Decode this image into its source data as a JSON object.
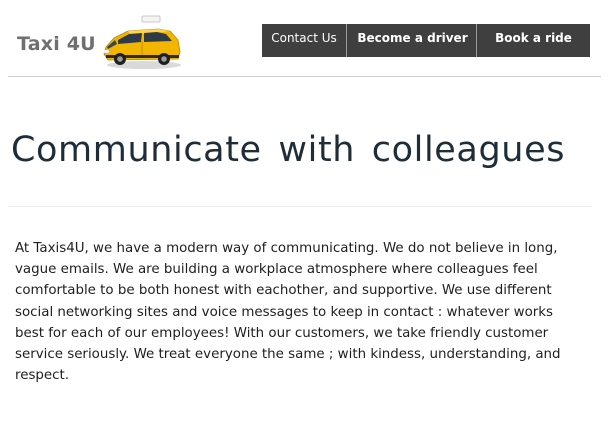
{
  "brand": {
    "name": "Taxi 4U"
  },
  "nav": {
    "contact_label": "Contact Us",
    "driver_label": "Become a driver",
    "ride_label": "Book a ride"
  },
  "hero": {
    "title": "Communicate  with  colleagues"
  },
  "content": {
    "paragraph": "At Taxis4U, we have a modern way of communicating. We do not believe in long, vague emails. We are building a workplace atmosphere where colleagues feel comfortable to be both honest with eachother, and supportive. We use different social networking sites and voice messages to keep in contact : whatever works best for each of our employees! With our customers, we take friendly customer service seriously. We treat everyone the same ; with kindess, understanding, and respect."
  },
  "colors": {
    "nav_background": "#3f3f3f",
    "taxi_yellow": "#f2b600",
    "title_color": "#1e2d38"
  },
  "icons": {
    "logo_image": "taxi-car-icon"
  }
}
